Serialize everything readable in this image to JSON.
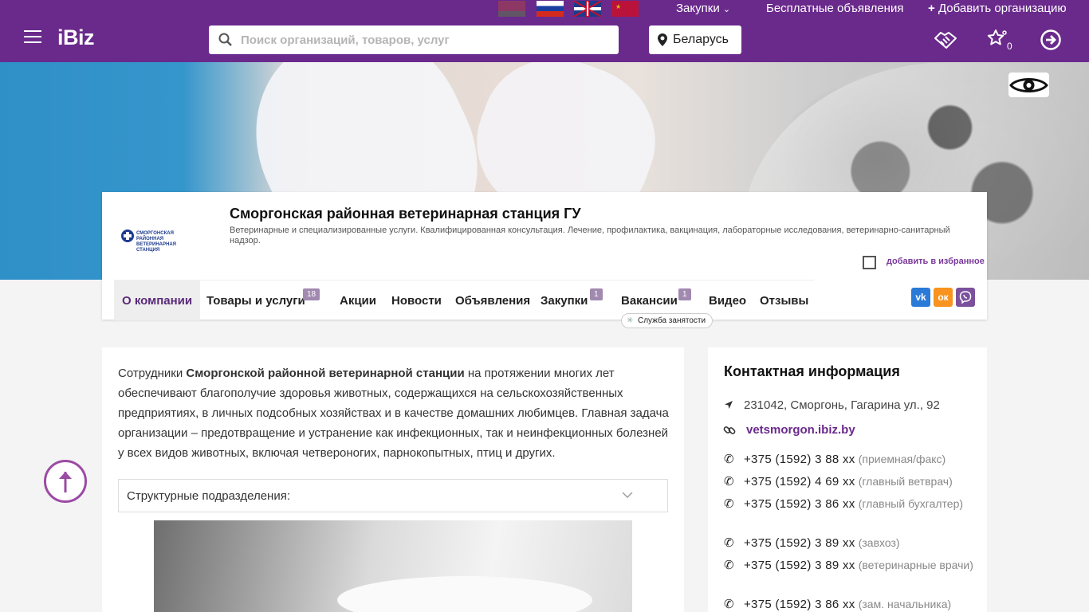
{
  "topbar": {
    "flags": [
      "by",
      "ru",
      "en",
      "cn"
    ],
    "purchases_label": "Закупки",
    "free_ads_label": "Бесплатные объявления",
    "add_org_label": "Добавить организацию"
  },
  "header": {
    "logo": "iBiz",
    "search_placeholder": "Поиск организаций, товаров, услуг",
    "country": "Беларусь",
    "favorites_count": "0"
  },
  "company": {
    "logo_text": "СМОРГОНСКАЯ РАЙОННАЯ ВЕТЕРИНАРНАЯ СТАНЦИЯ",
    "name": "Сморгонская районная ветеринарная станция ГУ",
    "description": "Ветеринарные и специализированные услуги. Квалифицированная консультация. Лечение, профилактика, вакцинация, лабораторные исследования, ветеринарно-санитарный надзор.",
    "favorite_label": "добавить в избранное",
    "tabs": [
      {
        "label": "О компании",
        "badge": ""
      },
      {
        "label": "Товары и услуги",
        "badge": "18"
      },
      {
        "label": "Акции",
        "badge": ""
      },
      {
        "label": "Новости",
        "badge": ""
      },
      {
        "label": "Объявления",
        "badge": ""
      },
      {
        "label": "Закупки",
        "badge": "1"
      },
      {
        "label": "Вакансии",
        "badge": "1"
      },
      {
        "label": "Видео",
        "badge": ""
      },
      {
        "label": "Отзывы",
        "badge": ""
      }
    ],
    "vacancy_tooltip": "Служба занятости",
    "social": [
      "vk",
      "ok",
      "viber"
    ]
  },
  "about": {
    "intro_before": "Сотрудники ",
    "intro_bold": "Сморгонской районной ветеринарной станции",
    "intro_after": " на протяжении многих лет обеспечивают благополучие здоровья животных, содержащихся на сельскохозяйственных предприятиях, в личных подсобных хозяйствах и в качестве домашних любимцев. Главная задача организации – предотвращение и устранение как инфекционных, так и неинфекционных болезней у всех видов животных, включая четвероногих, парнокопытных, птиц и других.",
    "accordion_label": "Структурные подразделения:"
  },
  "contacts": {
    "title": "Контактная информация",
    "address": "231042, Сморгонь, Гагарина ул., 92",
    "site": "vetsmorgon.ibiz.by",
    "phones": [
      {
        "number": "+375 (1592) 3 88 xx",
        "note": "(приемная/факс)"
      },
      {
        "number": "+375 (1592) 4 69 xx",
        "note": "(главный ветврач)"
      },
      {
        "number": "+375 (1592) 3 86 xx",
        "note": "(главный бухгалтер)"
      },
      {
        "number": "+375 (1592) 3 89 xx",
        "note": "(завхоз)"
      },
      {
        "number": "+375 (1592) 3 89 xx",
        "note": "(ветеринарные врачи)"
      },
      {
        "number": "+375 (1592) 3 86 xx",
        "note": "(зам. начальника)"
      }
    ]
  },
  "colors": {
    "brand": "#6a2a8c",
    "accent": "#9b4ba3",
    "badge": "#a189b0"
  }
}
